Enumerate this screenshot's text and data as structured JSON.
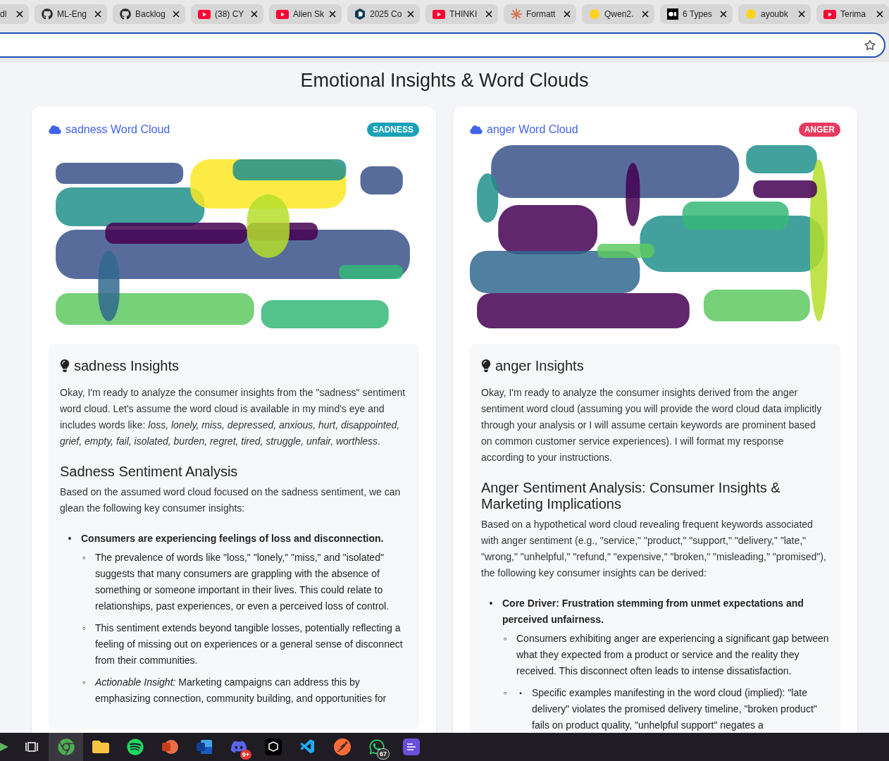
{
  "browser": {
    "tabs": [
      {
        "kind": "none",
        "title": "dl"
      },
      {
        "kind": "github",
        "title": "ML-Eng"
      },
      {
        "kind": "github",
        "title": "Backlog"
      },
      {
        "kind": "youtube",
        "title": "(38) CY"
      },
      {
        "kind": "youtube",
        "title": "Alien Sk"
      },
      {
        "kind": "hexagon",
        "title": "2025 Co"
      },
      {
        "kind": "youtube",
        "title": "THINKI"
      },
      {
        "kind": "burst",
        "title": "Formatt"
      },
      {
        "kind": "emoji",
        "title": "Qwen2."
      },
      {
        "kind": "square",
        "title": "6 Types"
      },
      {
        "kind": "emoji",
        "title": "ayoubk"
      },
      {
        "kind": "youtube",
        "title": "Terima"
      }
    ]
  },
  "page": {
    "title": "Emotional Insights & Word Clouds",
    "cards": [
      {
        "cloud_title": "sadness Word Cloud",
        "badge": "SADNESS",
        "color": "#17a2b8",
        "insights_title": "sadness Insights",
        "blocks": [
          {
            "kind": "paragraph",
            "text": "Okay, I'm ready to analyze the consumer insights from the \"sadness\" sentiment word cloud. Let's assume the word cloud is available in my mind's eye and includes words like: *loss, lonely, miss, depressed, anxious, hurt, disappointed, grief, empty, fail, isolated, burden, regret, tired, struggle, unfair, worthless*."
          },
          {
            "kind": "heading",
            "text": "Sadness Sentiment Analysis"
          },
          {
            "kind": "paragraph",
            "text": "Based on the assumed word cloud focused on the sadness sentiment, we can glean the following key consumer insights:"
          },
          {
            "kind": "list",
            "items": [
              {
                "marker": "•",
                "text": "Consumers are experiencing feelings of loss and disconnection.",
                "children": [
                  {
                    "marker": "◦",
                    "text": "The prevalence of words like \"loss,\" \"lonely,\" \"miss,\" and \"isolated\" suggests that many consumers are grappling with the absence of something or someone important in their lives. This could relate to relationships, past experiences, or even a perceived loss of control."
                  },
                  {
                    "marker": "◦",
                    "text": "This sentiment extends beyond tangible losses, potentially reflecting a feeling of missing out on experiences or a general sense of disconnect from their communities."
                  },
                  {
                    "marker": "◦",
                    "text": "*Actionable Insight:* Marketing campaigns can address this by emphasizing connection, community building, and opportunities for"
                  }
                ]
              }
            ]
          }
        ]
      },
      {
        "cloud_title": "anger Word Cloud",
        "badge": "ANGER",
        "color": "#e8395f",
        "insights_title": "anger Insights",
        "blocks": [
          {
            "kind": "paragraph",
            "text": "Okay, I'm ready to analyze the consumer insights derived from the anger sentiment word cloud (assuming you will provide the word cloud data implicitly through your analysis or I will assume certain keywords are prominent based on common customer service experiences). I will format my response according to your instructions."
          },
          {
            "kind": "heading",
            "text": "Anger Sentiment Analysis: Consumer Insights & Marketing Implications"
          },
          {
            "kind": "paragraph",
            "text": "Based on a hypothetical word cloud revealing frequent keywords associated with anger sentiment (e.g., \"service,\" \"product,\" \"support,\" \"delivery,\" \"late,\" \"wrong,\" \"unhelpful,\" \"refund,\" \"expensive,\" \"broken,\" \"misleading,\" \"promised\"), the following key consumer insights can be derived:"
          },
          {
            "kind": "list",
            "items": [
              {
                "marker": "•",
                "text": "Core Driver: Frustration stemming from unmet expectations and perceived unfairness.",
                "children": [
                  {
                    "marker": "◦",
                    "text": "Consumers exhibiting anger are experiencing a significant gap between what they expected from a product or service and the reality they received. This disconnect often leads to intense dissatisfaction."
                  },
                  {
                    "marker": "◦",
                    "children": [
                      {
                        "marker": "▪",
                        "text": "Specific examples manifesting in the word cloud (implied): \"late delivery\" violates the promised delivery timeline, \"broken product\" fails on product quality, \"unhelpful support\" negates a"
                      }
                    ]
                  }
                ]
              }
            ]
          }
        ]
      }
    ]
  },
  "taskbar": {
    "apps": [
      {
        "kind": "taskview",
        "selected": false
      },
      {
        "kind": "chrome",
        "selected": true
      },
      {
        "kind": "folder",
        "selected": false
      },
      {
        "kind": "spotify",
        "selected": false
      },
      {
        "kind": "powerpoint",
        "selected": false
      },
      {
        "kind": "word",
        "selected": false
      },
      {
        "kind": "discord",
        "selected": false,
        "badge": "9+"
      },
      {
        "kind": "cube",
        "selected": false
      },
      {
        "kind": "vscode",
        "selected": false
      },
      {
        "kind": "postman",
        "selected": false
      },
      {
        "kind": "whatsapp",
        "selected": false,
        "badge": "67"
      },
      {
        "kind": "notes",
        "selected": false
      }
    ]
  }
}
